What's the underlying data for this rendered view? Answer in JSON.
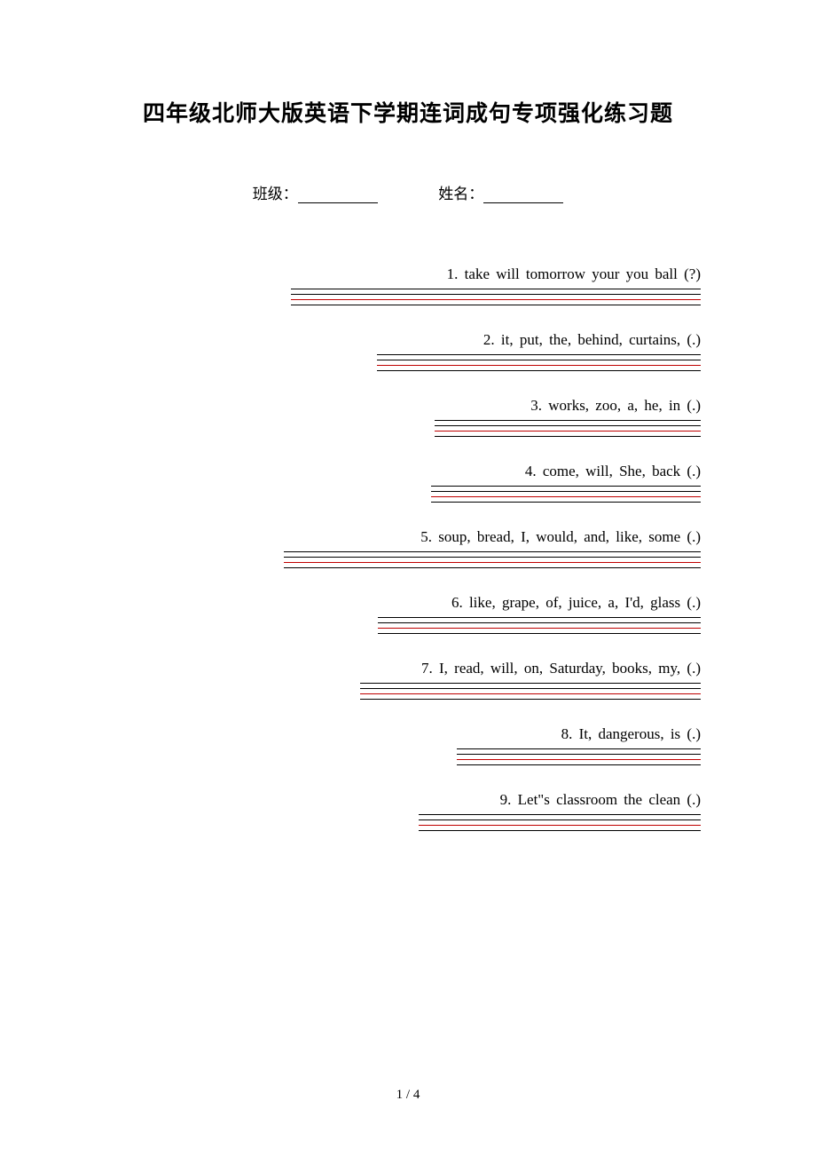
{
  "title": "四年级北师大版英语下学期连词成句专项强化练习题",
  "header": {
    "class_label": "班级：",
    "name_label": "姓名："
  },
  "questions": [
    {
      "text": "1. take   will   tomorrow   your   you   ball (?)",
      "line_width": 462
    },
    {
      "text": "2. it, put, the, behind, curtains, (.)",
      "line_width": 365
    },
    {
      "text": "3. works, zoo, a, he, in (.)",
      "line_width": 300
    },
    {
      "text": "4. come, will, She, back (.)",
      "line_width": 304
    },
    {
      "text": "5. soup,  bread,  I,  would,  and,  like,  some (.)",
      "line_width": 470
    },
    {
      "text": "6. like, grape, of, juice, a, I'd, glass (.)",
      "line_width": 364
    },
    {
      "text": "7. I, read, will, on, Saturday, books, my, (.)",
      "line_width": 384
    },
    {
      "text": "8. It, dangerous, is (.)",
      "line_width": 275
    },
    {
      "text": "9. Let\"s    classroom    the    clean    (.)",
      "line_width": 318
    }
  ],
  "footer": {
    "page": "1 / 4"
  }
}
